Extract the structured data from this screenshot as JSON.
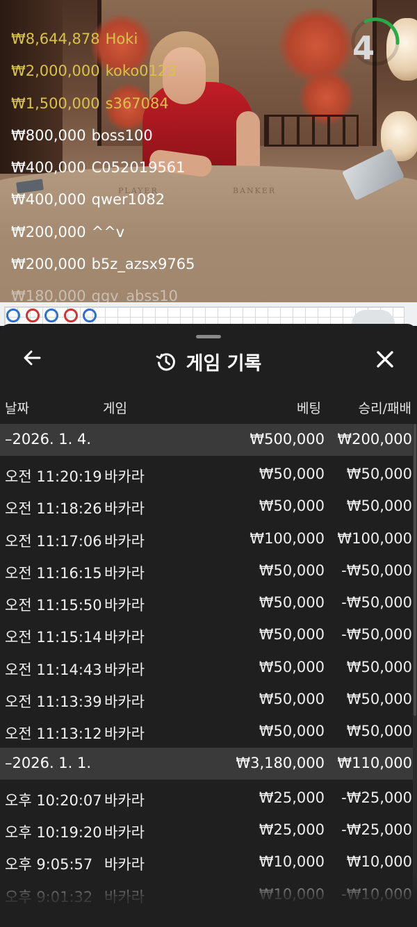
{
  "video": {
    "timer": {
      "value": "4",
      "color": "#2aa84a"
    },
    "table_labels": {
      "player": "PLAYER",
      "banker": "BANKER"
    },
    "winners": [
      {
        "amount": "₩8,644,878",
        "name": "Hoki",
        "color": "#d8c24a"
      },
      {
        "amount": "₩2,000,000",
        "name": "koko0123",
        "color": "#d8c24a"
      },
      {
        "amount": "₩1,500,000",
        "name": "s367084",
        "color": "#d8c24a"
      },
      {
        "amount": "₩800,000",
        "name": "boss100",
        "color": "#ffffff"
      },
      {
        "amount": "₩400,000",
        "name": "C052019561",
        "color": "#ffffff"
      },
      {
        "amount": "₩400,000",
        "name": "qwer1082",
        "color": "#ffffff"
      },
      {
        "amount": "₩200,000",
        "name": "^^v",
        "color": "#ffffff"
      },
      {
        "amount": "₩200,000",
        "name": "b5z_azsx9765",
        "color": "#ffffff"
      },
      {
        "amount": "₩180,000",
        "name": "ggv_abss10",
        "color": "#ffffff"
      }
    ]
  },
  "road": {
    "beads": [
      {
        "color": "#2d6fd1"
      },
      {
        "color": "#d23232"
      },
      {
        "color": "#2d6fd1"
      },
      {
        "color": "#d23232"
      },
      {
        "color": "#2d6fd1"
      }
    ]
  },
  "sheet": {
    "title": "게임 기록",
    "icons": {
      "back": "arrow-left-icon",
      "history": "history-icon",
      "close": "close-icon"
    },
    "columns": {
      "date": "날짜",
      "game": "게임",
      "bet": "베팅",
      "win_loss": "승리/패배"
    },
    "groups": [
      {
        "date": "–2026. 1. 4.",
        "total_bet": "₩500,000",
        "total_win": "₩200,000",
        "rows": [
          {
            "time": "오전 11:20:19",
            "game": "바카라",
            "bet": "₩50,000",
            "result": "₩50,000"
          },
          {
            "time": "오전 11:18:26",
            "game": "바카라",
            "bet": "₩50,000",
            "result": "₩50,000"
          },
          {
            "time": "오전 11:17:06",
            "game": "바카라",
            "bet": "₩100,000",
            "result": "₩100,000"
          },
          {
            "time": "오전 11:16:15",
            "game": "바카라",
            "bet": "₩50,000",
            "result": "-₩50,000"
          },
          {
            "time": "오전 11:15:50",
            "game": "바카라",
            "bet": "₩50,000",
            "result": "-₩50,000"
          },
          {
            "time": "오전 11:15:14",
            "game": "바카라",
            "bet": "₩50,000",
            "result": "-₩50,000"
          },
          {
            "time": "오전 11:14:43",
            "game": "바카라",
            "bet": "₩50,000",
            "result": "₩50,000"
          },
          {
            "time": "오전 11:13:39",
            "game": "바카라",
            "bet": "₩50,000",
            "result": "₩50,000"
          },
          {
            "time": "오전 11:13:12",
            "game": "바카라",
            "bet": "₩50,000",
            "result": "₩50,000"
          }
        ]
      },
      {
        "date": "–2026. 1. 1.",
        "total_bet": "₩3,180,000",
        "total_win": "₩110,000",
        "rows": [
          {
            "time": "오후 10:20:07",
            "game": "바카라",
            "bet": "₩25,000",
            "result": "-₩25,000"
          },
          {
            "time": "오후 10:19:20",
            "game": "바카라",
            "bet": "₩25,000",
            "result": "-₩25,000"
          },
          {
            "time": "오후 9:05:57",
            "game": "바카라",
            "bet": "₩10,000",
            "result": "₩10,000"
          },
          {
            "time": "오후 9:01:32",
            "game": "바카라",
            "bet": "₩10,000",
            "result": "-₩10,000"
          }
        ]
      }
    ]
  }
}
